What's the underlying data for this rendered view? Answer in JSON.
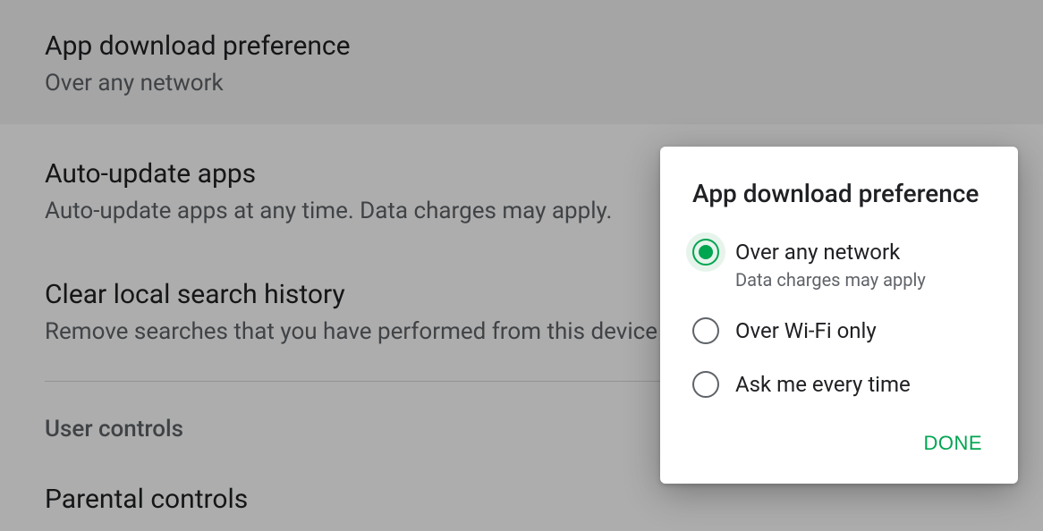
{
  "settings": {
    "items": [
      {
        "title": "App download preference",
        "subtitle": "Over any network"
      },
      {
        "title": "Auto-update apps",
        "subtitle": "Auto-update apps at any time. Data charges may apply."
      },
      {
        "title": "Clear local search history",
        "subtitle": "Remove searches that you have performed from this device"
      }
    ],
    "section_header": "User controls",
    "parental": {
      "title": "Parental controls"
    }
  },
  "dialog": {
    "title": "App download preference",
    "options": [
      {
        "label": "Over any network",
        "sublabel": "Data charges may apply",
        "selected": true
      },
      {
        "label": "Over Wi-Fi only",
        "selected": false
      },
      {
        "label": "Ask me every time",
        "selected": false
      }
    ],
    "done_label": "DONE"
  }
}
